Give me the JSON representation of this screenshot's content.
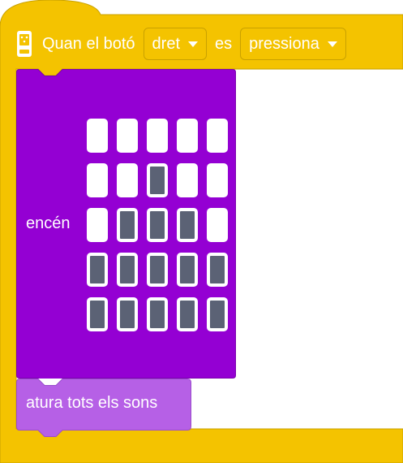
{
  "hat_block": {
    "text_prefix": "Quan el botó",
    "button_dropdown": "dret",
    "text_middle": "es",
    "event_dropdown": "pressiona",
    "colors": {
      "fill": "#f4c300",
      "stroke": "#c9a100"
    }
  },
  "light_block": {
    "label": "encén",
    "colors": {
      "fill": "#9400d3",
      "stroke": "#7a00ad",
      "led_on": "#5b6275",
      "led_off": "#ffffff"
    },
    "grid": [
      [
        0,
        0,
        0,
        0,
        0
      ],
      [
        0,
        0,
        1,
        0,
        0
      ],
      [
        0,
        1,
        1,
        1,
        0
      ],
      [
        1,
        1,
        1,
        1,
        1
      ],
      [
        1,
        1,
        1,
        1,
        1
      ]
    ]
  },
  "stop_block": {
    "label": "atura tots els sons",
    "colors": {
      "fill": "#b660e6",
      "stroke": "#9a4ccc"
    }
  }
}
